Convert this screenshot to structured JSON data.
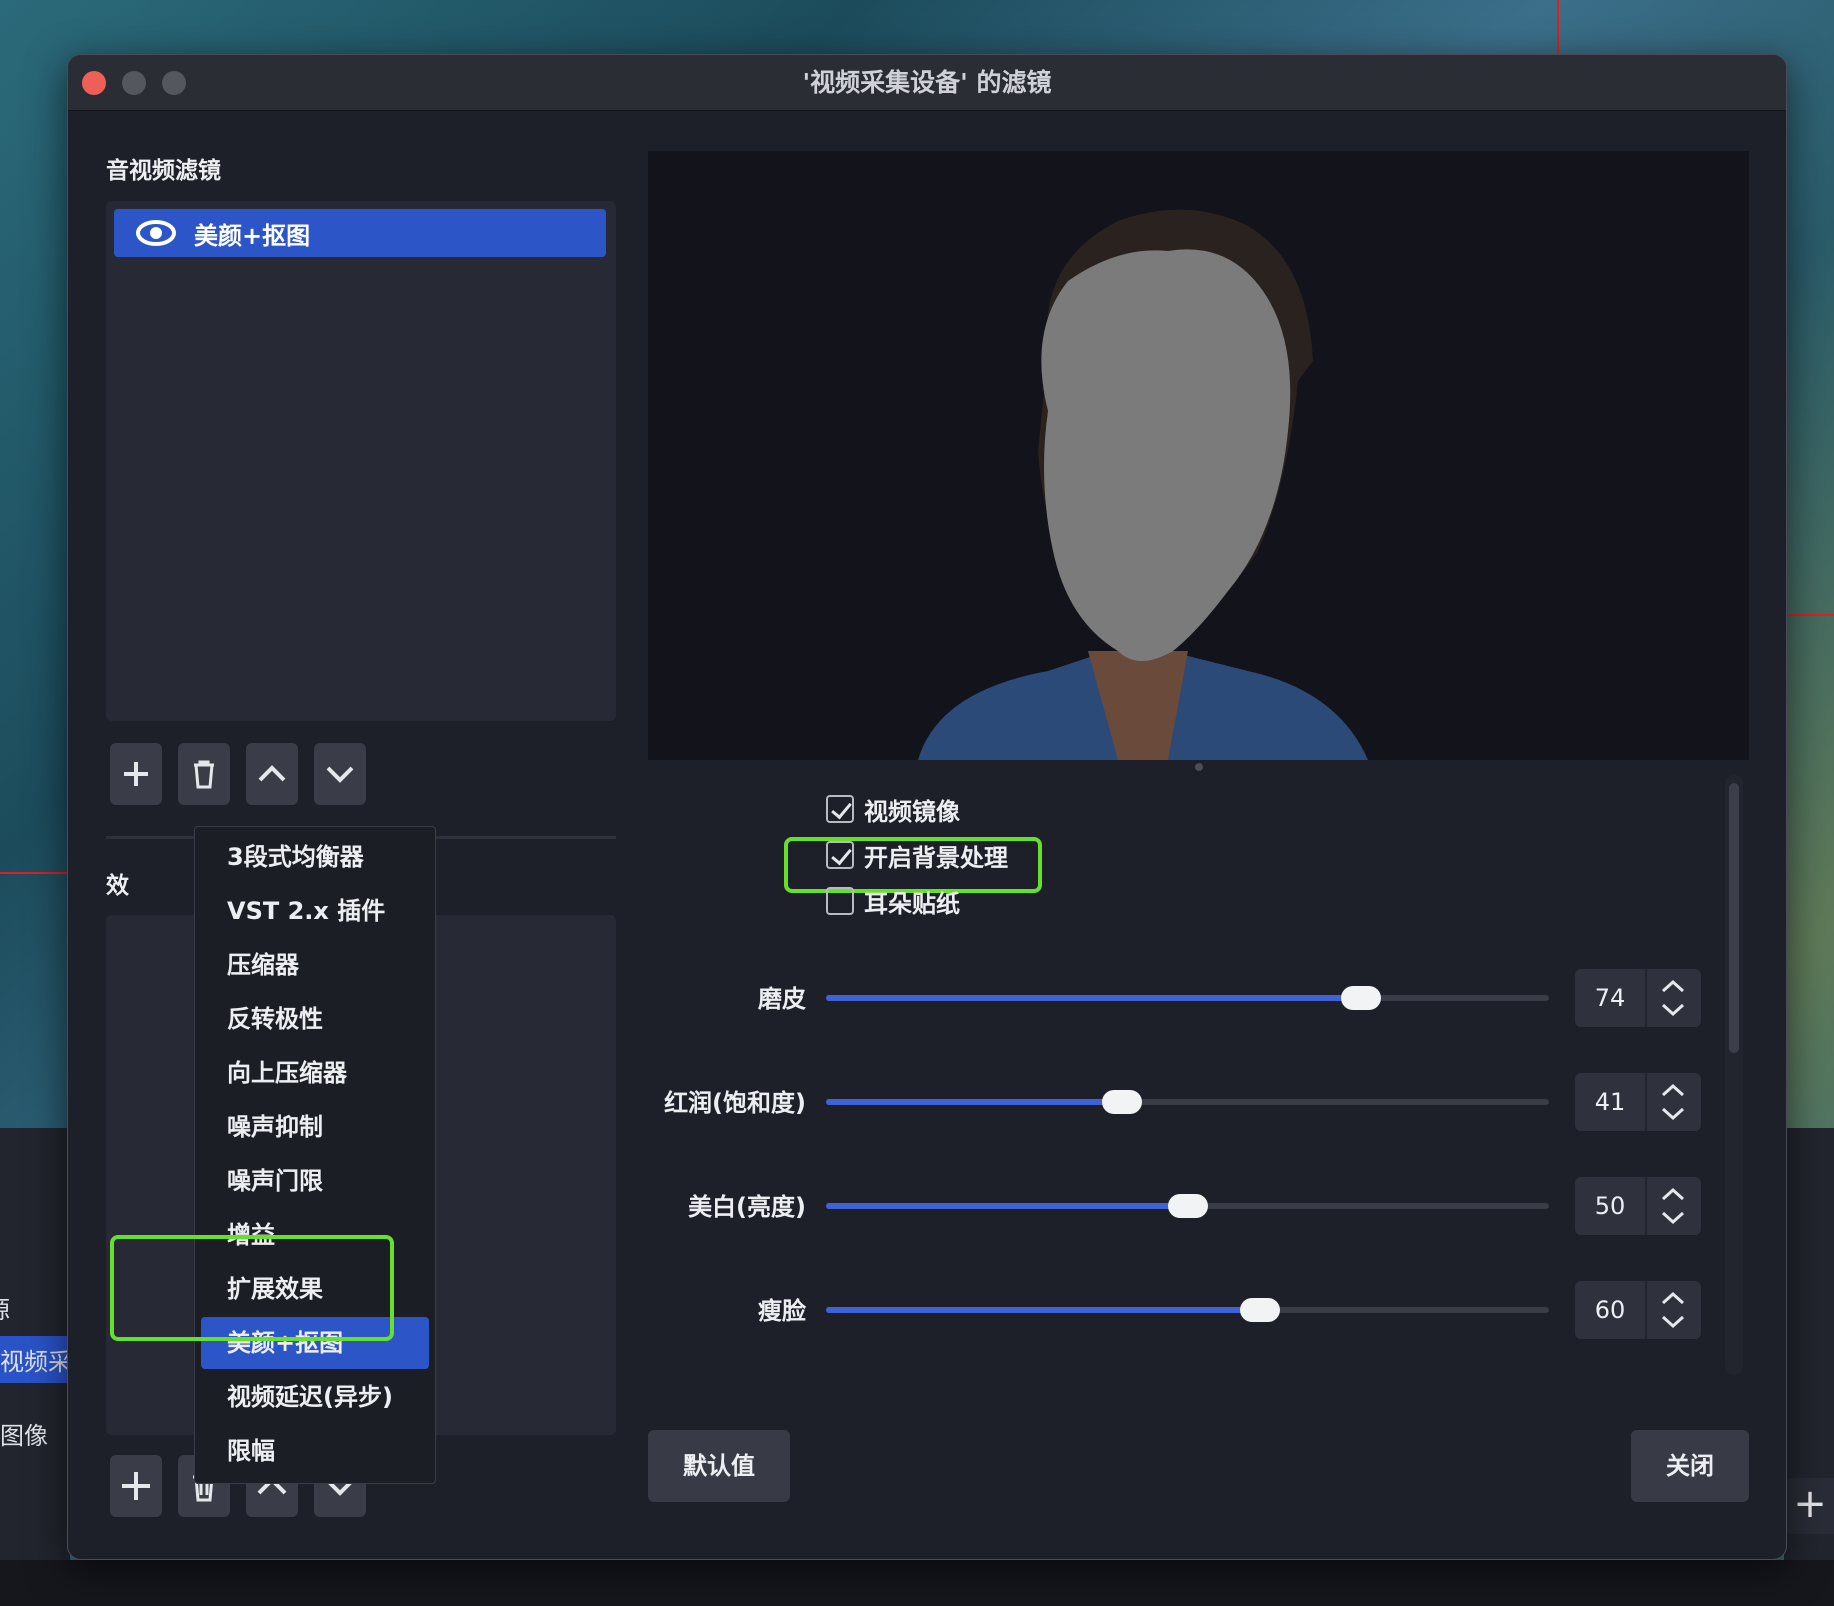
{
  "window": {
    "title": "'视频采集设备' 的滤镜"
  },
  "filters_panel": {
    "section_label": "音视频滤镜",
    "items": [
      {
        "label": "美颜+抠图",
        "visible": true
      }
    ]
  },
  "effects_panel": {
    "section_label_partial": "效"
  },
  "add_filter_menu": {
    "items": [
      "3段式均衡器",
      "VST 2.x 插件",
      "压缩器",
      "反转极性",
      "向上压缩器",
      "噪声抑制",
      "噪声门限",
      "增益",
      "扩展效果",
      "美颜+抠图",
      "视频延迟(异步)",
      "限幅"
    ],
    "selected": "美颜+抠图"
  },
  "options": {
    "checkboxes": [
      {
        "label": "视频镜像",
        "checked": true
      },
      {
        "label": "开启背景处理",
        "checked": true,
        "highlighted": true
      },
      {
        "label": "耳朵贴纸",
        "checked": false
      }
    ],
    "sliders": [
      {
        "label": "磨皮",
        "value": "74",
        "min": 0,
        "max": 100
      },
      {
        "label": "红润(饱和度)",
        "value": "41",
        "min": 0,
        "max": 100
      },
      {
        "label": "美白(亮度)",
        "value": "50",
        "min": 0,
        "max": 100
      },
      {
        "label": "瘦脸",
        "value": "60",
        "min": 0,
        "max": 100
      }
    ]
  },
  "buttons": {
    "defaults": "默认值",
    "close": "关闭"
  },
  "background_obs": {
    "left_items": [
      "源",
      "视频采",
      "图像"
    ]
  },
  "colors": {
    "accent": "#2c55c7",
    "highlight": "#66e12b",
    "slider_fill": "#3f63d6"
  }
}
